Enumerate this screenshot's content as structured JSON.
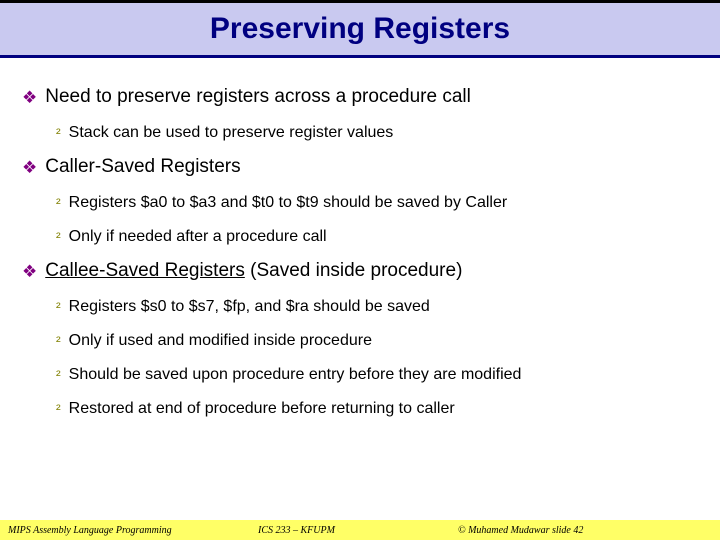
{
  "title": "Preserving Registers",
  "bullets": {
    "b1": "Need to preserve registers across a procedure call",
    "b1_1": "Stack can be used to preserve register values",
    "b2": "Caller-Saved Registers",
    "b2_1": "Registers $a0 to $a3 and $t0 to $t9 should be saved by Caller",
    "b2_2": "Only if needed after a procedure call",
    "b3_prefix": "Callee-Saved Registers",
    "b3_suffix": " (Saved inside procedure)",
    "b3_1": "Registers $s0 to $s7, $fp, and $ra should be saved",
    "b3_2": "Only if used and modified inside procedure",
    "b3_3": "Should be saved upon procedure entry before they are modified",
    "b3_4": "Restored at end of procedure before returning to caller"
  },
  "footer": {
    "left": "MIPS Assembly Language Programming",
    "mid": "ICS 233 – KFUPM",
    "right": "© Muhamed Mudawar   slide 42"
  }
}
